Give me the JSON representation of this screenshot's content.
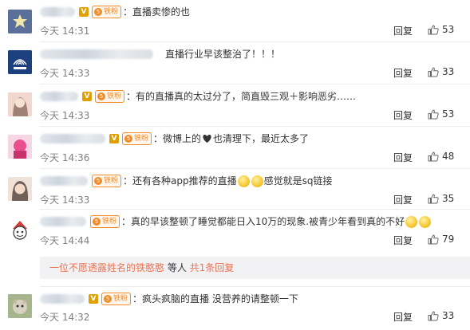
{
  "comments": [
    {
      "id": "c1",
      "user_suffix": "",
      "text": "：直播卖惨的也",
      "time": "今天 14:31",
      "reply": "回复",
      "likes": "53",
      "badges": [
        "v",
        "fan"
      ]
    },
    {
      "id": "c2",
      "user_suffix": "",
      "text": "直播行业早该整治了！！！",
      "time": "今天 14:33",
      "reply": "回复",
      "likes": "33",
      "badges": []
    },
    {
      "id": "c3",
      "user_suffix": "",
      "text": "：有的直播真的太过分了，简直毁三观＋影响恶劣……",
      "time": "今天 14:33",
      "reply": "回复",
      "likes": "53",
      "badges": [
        "v",
        "fan"
      ]
    },
    {
      "id": "c4",
      "user_suffix": "",
      "text_before": "：微博上的",
      "text_after": "也清理下，最近太多了",
      "time": "今天 14:36",
      "reply": "回复",
      "likes": "48",
      "badges": [
        "v",
        "fan"
      ]
    },
    {
      "id": "c5",
      "user_suffix": "",
      "text_before": "：还有各种app推荐的直播",
      "text_after": "感觉就是sq链接",
      "time": "今天 14:33",
      "reply": "回复",
      "likes": "35",
      "badges": [
        "fan"
      ]
    },
    {
      "id": "c6",
      "user_suffix": "",
      "text": "：真的早该整顿了睡觉都能日入10万的现象.被青少年看到真的不好",
      "time": "今天 14:44",
      "reply": "回复",
      "likes": "79",
      "badges": [
        "fan"
      ]
    },
    {
      "id": "c7",
      "user_suffix": "",
      "text": "：疯头疯脑的直播 没营养的请整顿一下",
      "time": "今天 14:32",
      "reply": "回复",
      "likes": "33",
      "badges": [
        "v",
        "fan"
      ]
    }
  ],
  "subreply": {
    "name": "一位不愿透露姓名的铁憨憨",
    "middle": " 等人 ",
    "count_link": "共1条回复"
  },
  "badge": {
    "v": "V",
    "fan": "铁粉",
    "level": "5"
  },
  "colors": {
    "accent": "#eb7350",
    "time": "#808080",
    "fan_badge": "#f08c2a"
  },
  "icons": {
    "like": "thumbs-up-icon",
    "emoji_smile": "smile-emoji-icon",
    "emoji_heart": "heart-emoji-icon",
    "emoji_laugh": "laugh-cry-emoji-icon"
  }
}
